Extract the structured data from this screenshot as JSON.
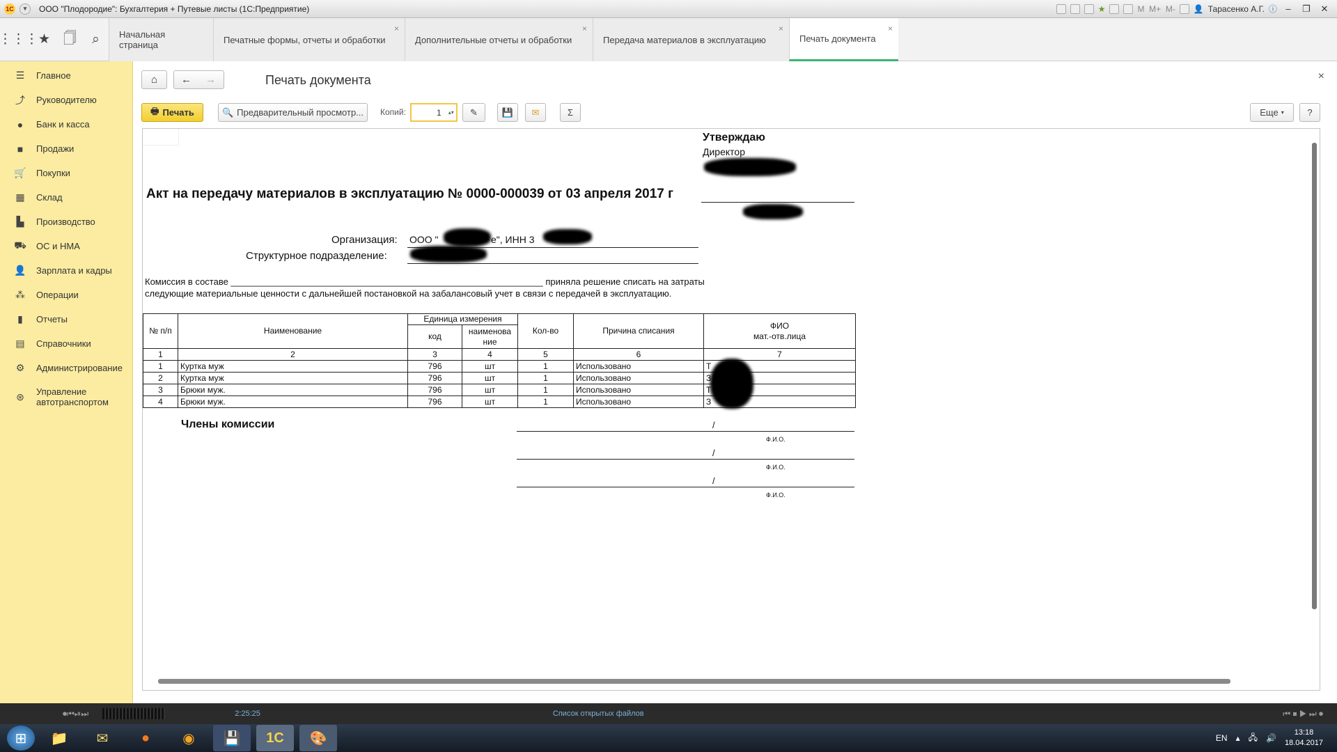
{
  "window": {
    "title": "ООО \"Плодородие\": Бухгалтерия + Путевые листы (1С:Предприятие)",
    "user": "Тарасенко А.Г."
  },
  "tabs": [
    {
      "label": "Начальная страница"
    },
    {
      "label": "Печатные формы, отчеты и обработки"
    },
    {
      "label": "Дополнительные отчеты и обработки"
    },
    {
      "label": "Передача материалов в эксплуатацию"
    },
    {
      "label": "Печать документа"
    }
  ],
  "sidebar": {
    "items": [
      {
        "label": "Главное",
        "icon": "menu-lines-icon"
      },
      {
        "label": "Руководителю",
        "icon": "trend-icon"
      },
      {
        "label": "Банк и касса",
        "icon": "coin-icon"
      },
      {
        "label": "Продажи",
        "icon": "bag-icon"
      },
      {
        "label": "Покупки",
        "icon": "cart-icon"
      },
      {
        "label": "Склад",
        "icon": "grid-icon"
      },
      {
        "label": "Производство",
        "icon": "factory-icon"
      },
      {
        "label": "ОС и НМА",
        "icon": "truck-icon"
      },
      {
        "label": "Зарплата и кадры",
        "icon": "person-icon"
      },
      {
        "label": "Операции",
        "icon": "operations-icon"
      },
      {
        "label": "Отчеты",
        "icon": "bar-chart-icon"
      },
      {
        "label": "Справочники",
        "icon": "book-icon"
      },
      {
        "label": "Администрирование",
        "icon": "gear-icon"
      },
      {
        "label": "Управление автотранспортом",
        "icon": "steering-icon"
      }
    ]
  },
  "form": {
    "title": "Печать документа",
    "print_label": "Печать",
    "preview_label": "Предварительный просмотр...",
    "copies_label": "Копий:",
    "copies_value": "1",
    "more_label": "Еще",
    "help_label": "?"
  },
  "document": {
    "approve": "Утверждаю",
    "director": "Директор",
    "title": "Акт на передачу материалов в эксплуатацию № 0000-000039 от 03 апреля 2017 г",
    "org_label": "Организация:",
    "org_value": "ООО \"",
    "org_value2": "е\", ИНН 3",
    "dept_label": "Структурное подразделение:",
    "commission_text1": "Комиссия в составе ______________________________________________________________  приняла решение списать на затраты",
    "commission_text2": "следующие материальные ценности с дальнейшей постановкой на забалансовый учет в связи с передачей в эксплуатацию.",
    "headers": {
      "num": "№ п/п",
      "name": "Наименование",
      "unit": "Единица измерения",
      "code": "код",
      "unit_name": "наименова ние",
      "qty": "Кол-во",
      "reason": "Причина списания",
      "fio": "ФИО",
      "fio_sub": "мат.-отв.лица"
    },
    "col_numbers": [
      "1",
      "2",
      "3",
      "4",
      "5",
      "6",
      "7"
    ],
    "rows": [
      {
        "n": "1",
        "name": "Куртка муж",
        "code": "796",
        "unit": "шт",
        "qty": "1",
        "reason": "Использовано",
        "fio": "Т"
      },
      {
        "n": "2",
        "name": "Куртка муж",
        "code": "796",
        "unit": "шт",
        "qty": "1",
        "reason": "Использовано",
        "fio": "З"
      },
      {
        "n": "3",
        "name": "Брюки муж.",
        "code": "796",
        "unit": "шт",
        "qty": "1",
        "reason": "Использовано",
        "fio": "Т"
      },
      {
        "n": "4",
        "name": "Брюки муж.",
        "code": "796",
        "unit": "шт",
        "qty": "1",
        "reason": "Использовано",
        "fio": "З"
      }
    ],
    "members_label": "Члены комиссии",
    "slash": "/",
    "fio_caption": "Ф.И.О."
  },
  "statusbar": {
    "text": "Список открытых файлов",
    "time": "2:25:25"
  },
  "taskbar": {
    "lang": "EN",
    "time": "13:18",
    "date": "18.04.2017"
  },
  "colors": {
    "sidebar": "#fbeca1",
    "print_button": "#f2cf2d",
    "active_tab": "#3cb371"
  }
}
